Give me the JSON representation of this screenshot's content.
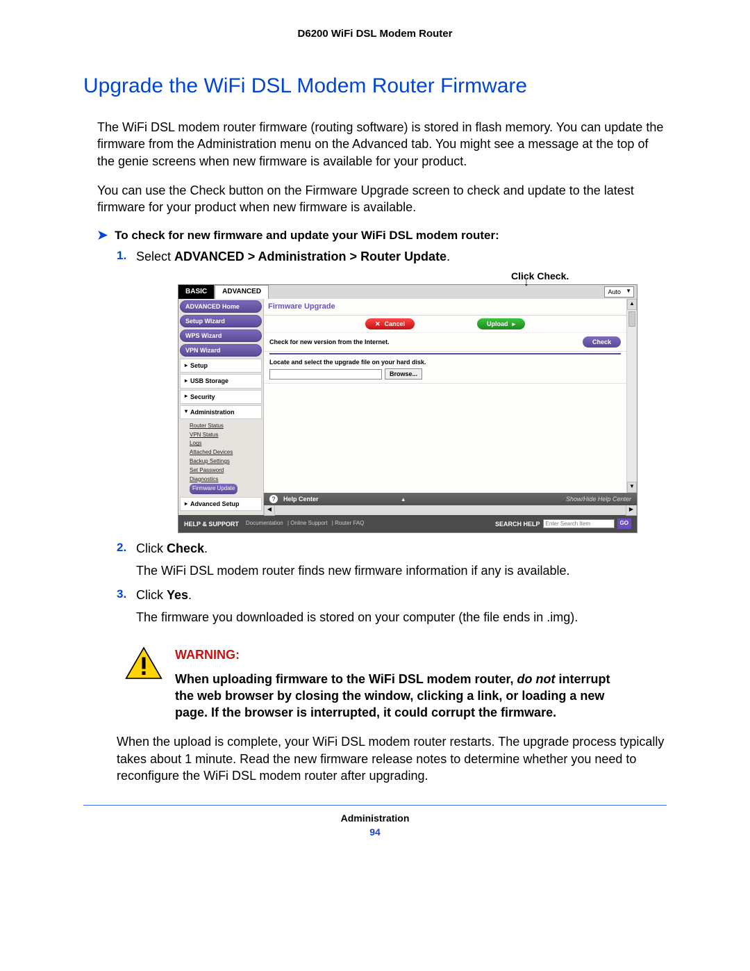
{
  "header": {
    "product": "D6200 WiFi DSL Modem Router"
  },
  "heading": "Upgrade the WiFi DSL Modem Router Firmware",
  "intro": [
    "The WiFi DSL modem router firmware (routing software) is stored in flash memory. You can update the firmware from the Administration menu on the Advanced tab. You might see a message at the top of the genie screens when new firmware is available for your product.",
    "You can use the Check button on the Firmware Upgrade screen to check and update to the latest firmware for your product when new firmware is available."
  ],
  "procedure_title": "To check for new firmware and update your WiFi DSL modem router:",
  "step1_prefix": "Select ",
  "step1_bold": "ADVANCED > Administration > Router Update",
  "step1_suffix": ".",
  "callout_label": "Click Check.",
  "screenshot": {
    "tabs": {
      "basic": "BASIC",
      "advanced": "ADVANCED"
    },
    "auto": "Auto",
    "side_buttons": [
      "ADVANCED Home",
      "Setup Wizard",
      "WPS Wizard",
      "VPN Wizard"
    ],
    "side_sections": [
      "Setup",
      "USB Storage",
      "Security"
    ],
    "admin_label": "Administration",
    "admin_items": [
      "Router Status",
      "VPN Status",
      "Logs",
      "Attached Devices",
      "Backup Settings",
      "Set Password",
      "Diagnostics"
    ],
    "admin_active": "Firmware Update",
    "adv_setup": "Advanced Setup",
    "panel_title": "Firmware Upgrade",
    "cancel": "Cancel",
    "upload": "Upload",
    "check_row_label": "Check for new version from the Internet.",
    "check": "Check",
    "locate_label": "Locate and select the upgrade file on your hard disk.",
    "browse": "Browse...",
    "help_center": "Help Center",
    "help_toggle": "Show/Hide Help Center",
    "footer_label": "HELP & SUPPORT",
    "footer_links": [
      "Documentation",
      "Online Support",
      "Router FAQ"
    ],
    "search_label": "SEARCH HELP",
    "search_placeholder": "Enter Search Item",
    "go": "GO"
  },
  "step2_text": "Click ",
  "step2_bold": "Check",
  "step2_sub": "The WiFi DSL modem router finds new firmware information if any is available.",
  "step3_text": "Click ",
  "step3_bold": "Yes",
  "step3_sub": "The firmware you downloaded is stored on your computer (the file ends in .img).",
  "warning": {
    "label": "WARNING:",
    "text_a": "When uploading firmware to the WiFi DSL modem router, ",
    "text_em": "do not",
    "text_b": " interrupt the web browser by closing the window, clicking a link, or loading a new page. If the browser is interrupted, it could corrupt the firmware."
  },
  "outro": "When the upload is complete, your WiFi DSL modem router restarts. The upgrade process typically takes about 1 minute. Read the new firmware release notes to determine whether you need to reconfigure the WiFi DSL modem router after upgrading.",
  "footer": {
    "section": "Administration",
    "page": "94"
  }
}
